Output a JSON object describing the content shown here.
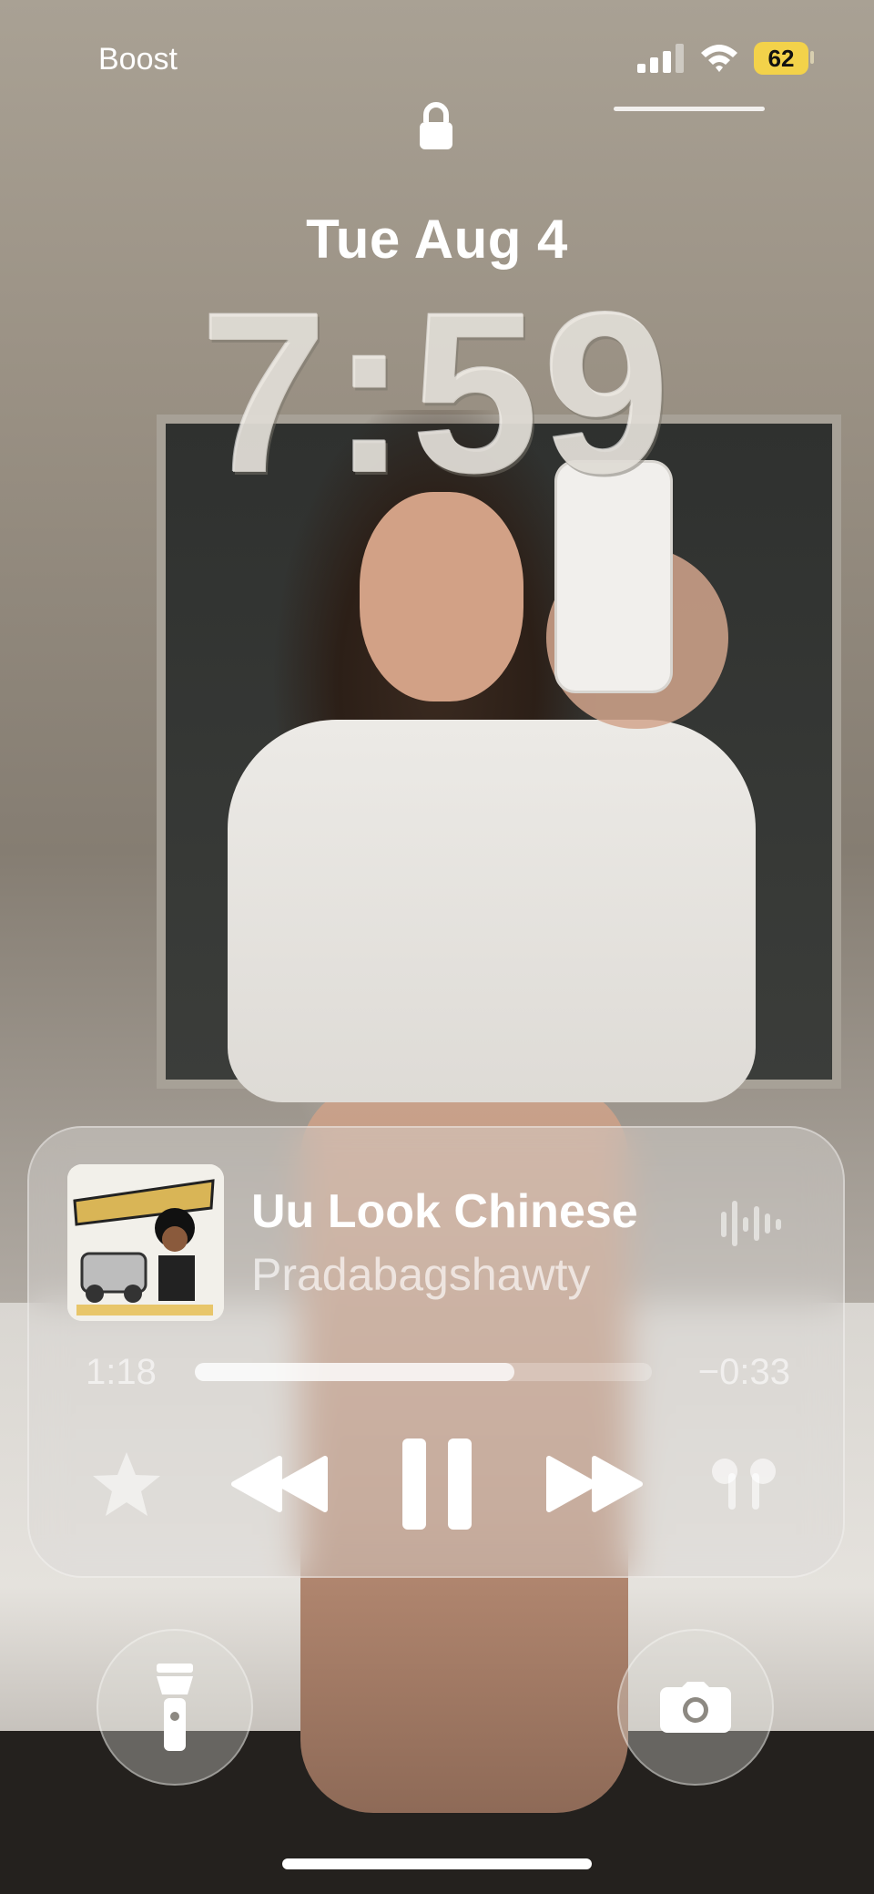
{
  "status_bar": {
    "carrier": "Boost",
    "battery_level": "62",
    "signal_icon": "cellular-signal-icon",
    "wifi_icon": "wifi-icon"
  },
  "lock_screen": {
    "date": "Tue Aug 4",
    "time": "7:59",
    "lock_icon": "lock-icon"
  },
  "now_playing": {
    "song_title": "Uu Look Chinese",
    "artist": "Pradabagshawty",
    "elapsed": "1:18",
    "remaining": "−0:33",
    "progress_fraction": 0.7,
    "controls": [
      "star-icon",
      "rewind-icon",
      "pause-icon",
      "fast-forward-icon",
      "airpods-icon"
    ],
    "album_art": "album-art-image"
  },
  "quick_actions": [
    "flashlight-icon",
    "camera-icon"
  ],
  "colors": {
    "battery": "#f3d24a",
    "text": "#ffffff"
  }
}
